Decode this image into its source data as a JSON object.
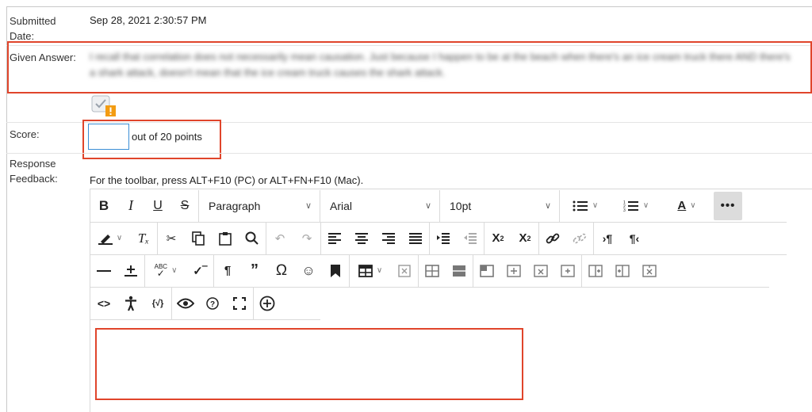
{
  "labels": {
    "submitted": "Submitted Date:",
    "given": "Given Answer:",
    "score": "Score:",
    "feedback": "Response Feedback:"
  },
  "submitted_value": "Sep 28, 2021 2:30:57 PM",
  "given_answer": "I recall that correlation does not necessarily mean causation. Just because I happen to be at the beach when there's an ice cream truck there AND there's a shark attack, doesn't mean that the ice cream truck causes the shark attack.",
  "score": {
    "value": "",
    "suffix": "out of 20 points"
  },
  "toolbar_hint": "For the toolbar, press ALT+F10 (PC) or ALT+FN+F10 (Mac).",
  "toolbar": {
    "block_format": "Paragraph",
    "font_family": "Arial",
    "font_size": "10pt"
  },
  "colors": {
    "highlight_red": "#e0452b",
    "input_blue": "#3b8fd6"
  }
}
